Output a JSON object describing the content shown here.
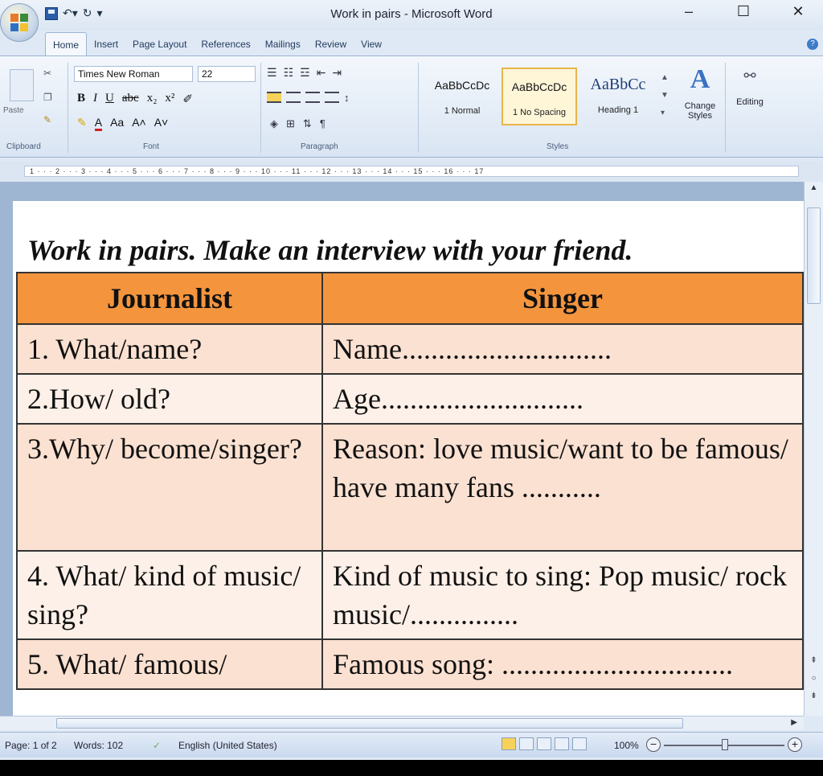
{
  "window": {
    "title": "Work in pairs - Microsoft Word"
  },
  "ribbon": {
    "tabs": [
      "Home",
      "Insert",
      "Page Layout",
      "References",
      "Mailings",
      "Review",
      "View"
    ],
    "clipboard_label": "Clipboard",
    "paste_label": "Paste",
    "font_name": "Times New Roman",
    "font_size": "22",
    "font_group_label": "Font",
    "paragraph_group_label": "Paragraph",
    "styles_group_label": "Styles",
    "styles": [
      {
        "sample": "AaBbCcDc",
        "name": "1 Normal"
      },
      {
        "sample": "AaBbCcDc",
        "name": "1 No Spacing"
      },
      {
        "sample": "AaBbCc",
        "name": "Heading 1"
      }
    ],
    "change_styles": "Change Styles",
    "editing": "Editing"
  },
  "ruler": {
    "marks": "1 · · · 2 · · · 3 · · · 4 · · · 5 · · · 6 · · · 7 · · · 8 · · · 9 · · · 10 · · · 11 · · · 12 · · · 13 · · · 14 · · · 15 · · · 16 · · · 17"
  },
  "document": {
    "heading": "Work in pairs. Make an interview with your friend.",
    "table": {
      "headers": [
        "Journalist",
        "Singer"
      ],
      "rows": [
        [
          "1. What/name?",
          "Name............................."
        ],
        [
          "2.How/ old?",
          "Age............................"
        ],
        [
          "3.Why/ become/singer?",
          "Reason: love music/want to be famous/ have many fans ..........."
        ],
        [
          "4. What/ kind of music/ sing?",
          "Kind of music to sing: Pop music/ rock music/..............."
        ],
        [
          "5. What/ famous/",
          "Famous song: ................................"
        ]
      ]
    }
  },
  "status": {
    "page": "Page: 1 of 2",
    "words": "Words: 102",
    "language": "English (United States)",
    "zoom": "100%"
  },
  "colors": {
    "header_fill": "#f4953e",
    "row_fill_a": "#fbe1d1",
    "row_fill_b": "#fdf0e8"
  }
}
